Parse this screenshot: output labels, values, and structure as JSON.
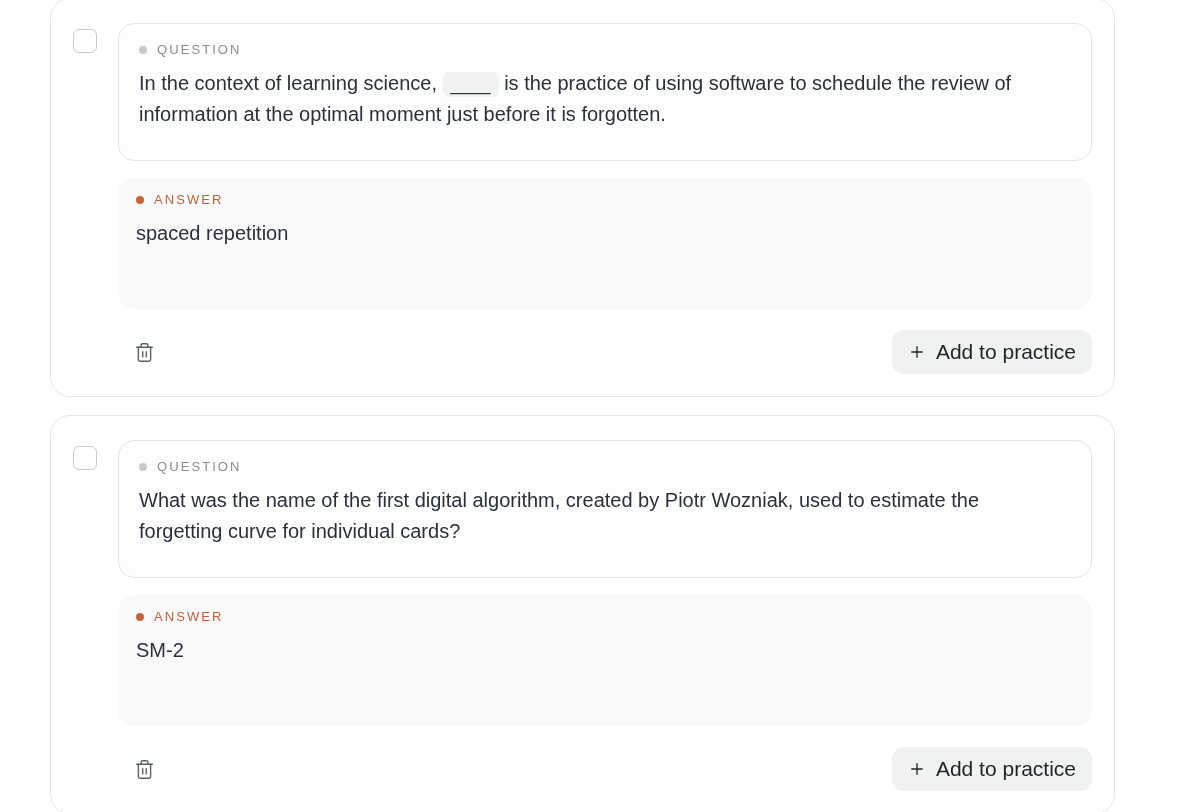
{
  "cards": [
    {
      "checked": false,
      "question": {
        "label": "QUESTION",
        "parts": [
          {
            "kind": "text",
            "text": "In the context of learning science,"
          },
          {
            "kind": "blank",
            "text": "____"
          },
          {
            "kind": "text",
            "text": "is the practice of using software to schedule the review of information at the optimal moment just before it is forgotten."
          }
        ]
      },
      "answer": {
        "label": "ANSWER",
        "text": "spaced repetition"
      },
      "action": "Add to practice"
    },
    {
      "checked": false,
      "question": {
        "label": "QUESTION",
        "parts": [
          {
            "kind": "text",
            "text": "What was the name of the first digital algorithm, created by Piotr Wozniak, used to estimate the forgetting curve for individual cards?"
          }
        ]
      },
      "answer": {
        "label": "ANSWER",
        "text": "SM-2"
      },
      "action": "Add to practice"
    }
  ]
}
